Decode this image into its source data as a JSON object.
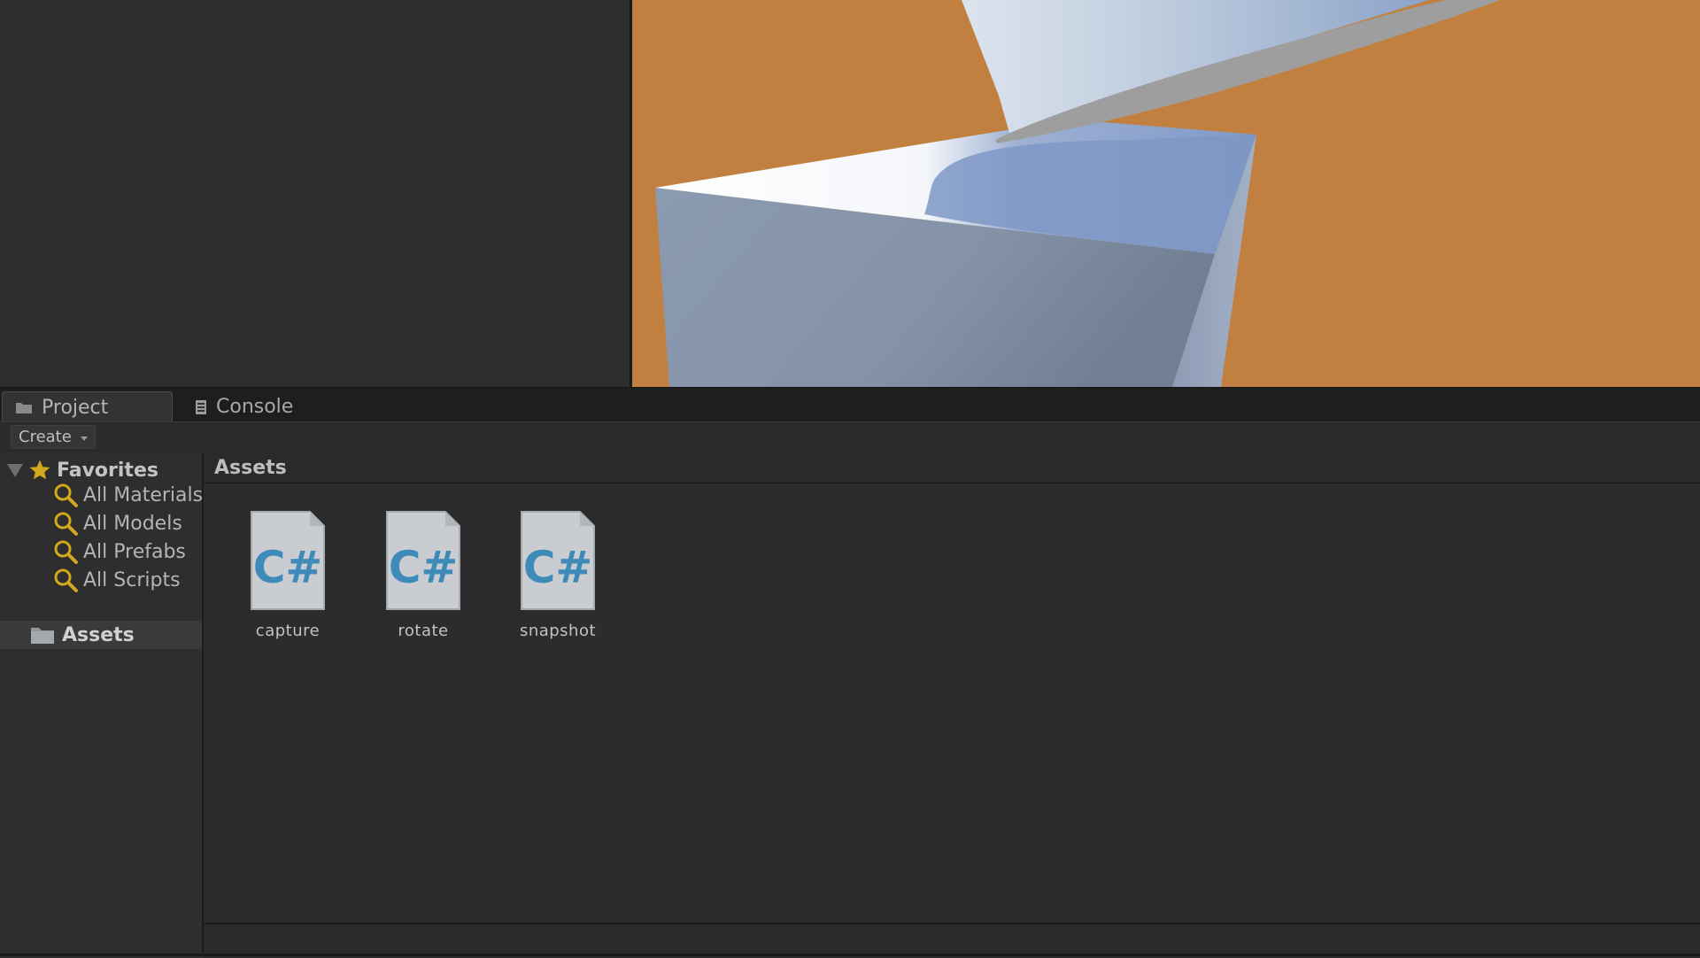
{
  "tabs": [
    {
      "label": "Project",
      "icon": "folder-icon",
      "active": true
    },
    {
      "label": "Console",
      "icon": "console-icon",
      "active": false
    }
  ],
  "toolbar": {
    "create_label": "Create"
  },
  "sidebar": {
    "favorites_label": "Favorites",
    "favorites": [
      {
        "label": "All Materials",
        "icon": "search-icon"
      },
      {
        "label": "All Models",
        "icon": "search-icon"
      },
      {
        "label": "All Prefabs",
        "icon": "search-icon"
      },
      {
        "label": "All Scripts",
        "icon": "search-icon"
      }
    ],
    "assets_label": "Assets"
  },
  "main": {
    "breadcrumb": "Assets",
    "assets": [
      {
        "name": "capture",
        "type": "csharp-script-icon"
      },
      {
        "name": "rotate",
        "type": "csharp-script-icon"
      },
      {
        "name": "snapshot",
        "type": "csharp-script-icon"
      }
    ]
  },
  "colors": {
    "viewport_background": "#c28040",
    "panel_background": "#2e2e2e",
    "accent_yellow": "#d4a81c",
    "script_icon_blue": "#3e8ab8"
  }
}
